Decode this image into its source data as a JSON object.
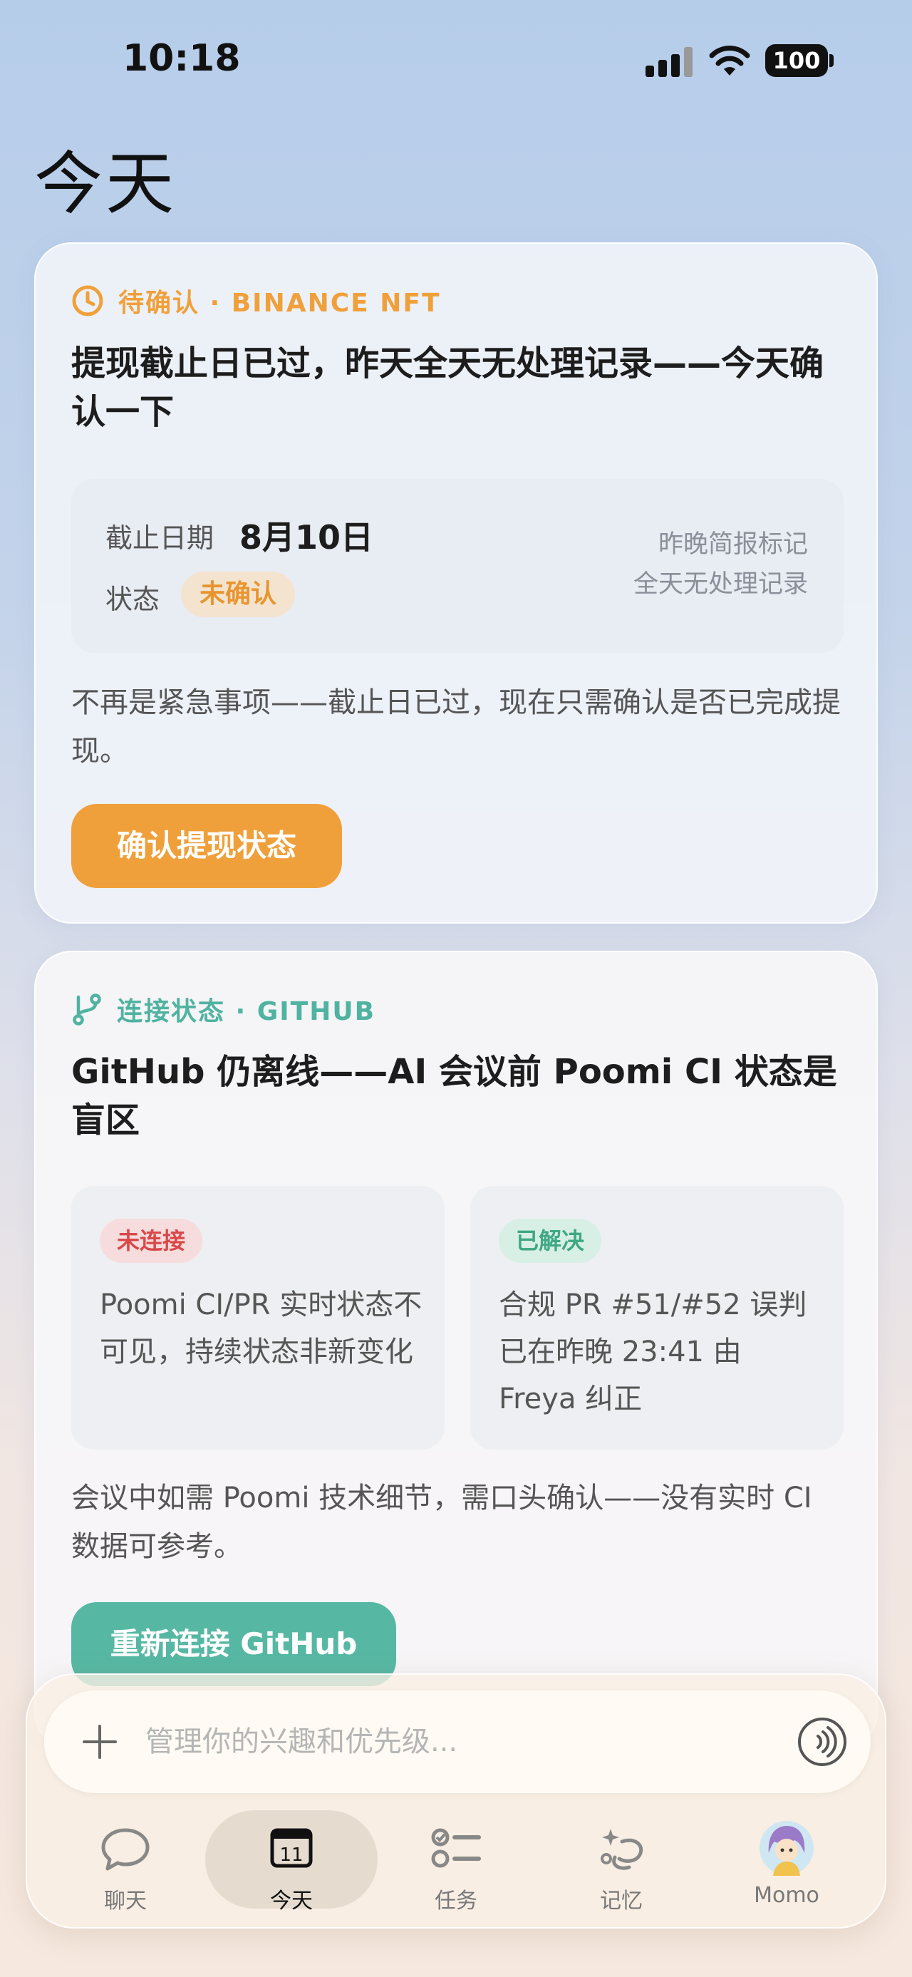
{
  "status_bar": {
    "time": "10:18",
    "battery": "100"
  },
  "page": {
    "title": "今天"
  },
  "cards": [
    {
      "tag": "待确认 · BINANCE NFT",
      "tag_color": "#f0a03a",
      "title": "提现截止日已过，昨天全天无处理记录——今天确认一下",
      "deadline_label": "截止日期",
      "deadline_value": "8月10日",
      "status_label": "状态",
      "status_value": "未确认",
      "note_line1": "昨晚简报标记",
      "note_line2": "全天无处理记录",
      "body": "不再是紧急事项——截止日已过，现在只需确认是否已完成提现。",
      "button": "确认提现状态",
      "button_color": "#f0a03a"
    },
    {
      "tag": "连接状态 · GITHUB",
      "tag_color": "#4fb3a0",
      "title": "GitHub 仍离线——AI 会议前 Poomi CI 状态是盲区",
      "left_badge": "未连接",
      "left_text": "Poomi CI/PR 实时状态不可见，持续状态非新变化",
      "right_badge": "已解决",
      "right_text": "合规 PR #51/#52 误判已在昨晚 23:41 由 Freya 纠正",
      "body": "会议中如需 Poomi 技术细节，需口头确认——没有实时 CI 数据可参考。",
      "button": "重新连接 GitHub",
      "button_color": "#56b8a3"
    }
  ],
  "input": {
    "placeholder": "管理你的兴趣和优先级..."
  },
  "nav": {
    "items": [
      {
        "label": "聊天",
        "icon": "chat-bubble-icon"
      },
      {
        "label": "今天",
        "icon": "calendar-icon",
        "day": "11"
      },
      {
        "label": "任务",
        "icon": "task-list-icon"
      },
      {
        "label": "记忆",
        "icon": "memory-icon"
      },
      {
        "label": "Momo",
        "icon": "avatar"
      }
    ]
  }
}
